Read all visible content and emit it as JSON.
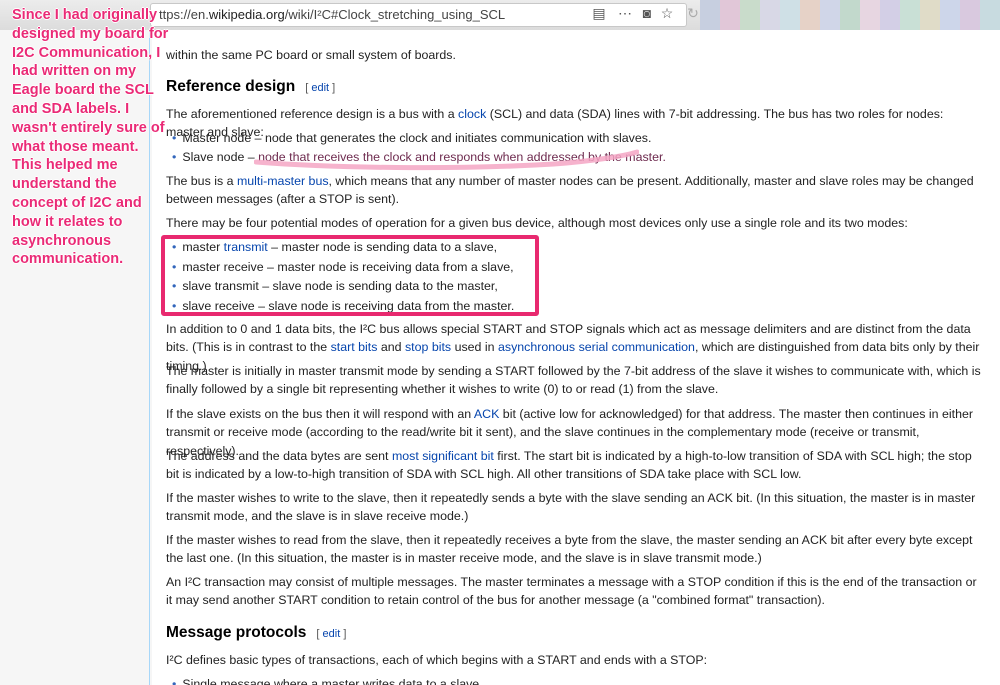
{
  "browser": {
    "url_prefix": "ttps://en.",
    "url_domain": "wikipedia.org",
    "url_path": "/wiki/I²C#Clock_stretching_using_SCL"
  },
  "annotation": {
    "text": "Since I had originally designed my board for I2C Communication, I had written on my Eagle board the SCL and SDA labels. I wasn't entirely sure of what those meant. This helped me understand the concept of I2C and how it relates to asynchronous communication."
  },
  "article": {
    "intro_tail": "within the same PC board or small system of boards.",
    "section1": {
      "title": "Reference design",
      "edit": "edit"
    },
    "p1": {
      "a": "The aforementioned reference design is a bus with a ",
      "link_clock": "clock",
      "b": " (SCL) and data (SDA) lines with 7-bit addressing. The bus has two roles for nodes: master and slave:"
    },
    "roles": [
      {
        "text": "Master node – node that generates the clock and initiates communication with slaves."
      },
      {
        "lead": "Slave node – ",
        "text": "node that receives the clock and responds when addressed by the master."
      }
    ],
    "p2": {
      "a": "The bus is a ",
      "link": "multi-master bus",
      "b": ", which means that any number of master nodes can be present. Additionally, master and slave roles may be changed between messages (after a STOP is sent)."
    },
    "p3": "There may be four potential modes of operation for a given bus device, although most devices only use a single role and its two modes:",
    "modes": {
      "m1a": "master ",
      "m1link": "transmit",
      "m1b": " – master node is sending data to a slave,",
      "m2": "master receive – master node is receiving data from a slave,",
      "m3": "slave transmit – slave node is sending data to the master,",
      "m4": "slave receive – slave node is receiving data from the master."
    },
    "p4": {
      "a": "In addition to 0 and 1 data bits, the I²C bus allows special START and STOP signals which act as message delimiters and are distinct from the data bits. (This is in contrast to the ",
      "link1": "start bits",
      "b": " and ",
      "link2": "stop bits",
      "c": " used in ",
      "link3": "asynchronous serial communication",
      "d": ", which are distinguished from data bits only by their timing.)"
    },
    "p5": "The master is initially in master transmit mode by sending a START followed by the 7-bit address of the slave it wishes to communicate with, which is finally followed by a single bit representing whether it wishes to write (0) to or read (1) from the slave.",
    "p6": {
      "a": "If the slave exists on the bus then it will respond with an ",
      "link": "ACK",
      "b": " bit (active low for acknowledged) for that address. The master then continues in either transmit or receive mode (according to the read/write bit it sent), and the slave continues in the complementary mode (receive or transmit, respectively)."
    },
    "p7": {
      "a": "The address and the data bytes are sent ",
      "link": "most significant bit",
      "b": " first. The start bit is indicated by a high-to-low transition of SDA with SCL high; the stop bit is indicated by a low-to-high transition of SDA with SCL high. All other transitions of SDA take place with SCL low."
    },
    "p8": "If the master wishes to write to the slave, then it repeatedly sends a byte with the slave sending an ACK bit. (In this situation, the master is in master transmit mode, and the slave is in slave receive mode.)",
    "p9": "If the master wishes to read from the slave, then it repeatedly receives a byte from the slave, the master sending an ACK bit after every byte except the last one. (In this situation, the master is in master receive mode, and the slave is in slave transmit mode.)",
    "p10": "An I²C transaction may consist of multiple messages. The master terminates a message with a STOP condition if this is the end of the transaction or it may send another START condition to retain control of the bus for another message (a \"combined format\" transaction).",
    "section2": {
      "title": "Message protocols",
      "edit": "edit"
    },
    "p11": "I²C defines basic types of transactions, each of which begins with a START and ends with a STOP:",
    "p12": "Single message where a master writes data to a slave."
  },
  "colors": {
    "annotation": "#ea2a76",
    "link": "#0645ad",
    "highlight_box": "#e8296f"
  }
}
